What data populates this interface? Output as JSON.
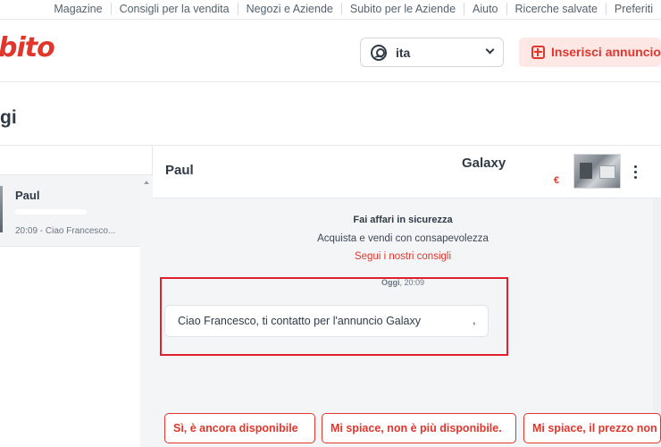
{
  "top_links": [
    "Magazine",
    "Consigli per la vendita",
    "Negozi e Aziende",
    "Subito per le Aziende",
    "Aiuto",
    "Ricerche salvate",
    "Preferiti"
  ],
  "header": {
    "logo_text": "bito",
    "language": "ita",
    "insert_ad_label": "Inserisci annuncio",
    "brand_color": "#e1362b"
  },
  "page": {
    "title": "gi"
  },
  "conversations": [
    {
      "name": "Paul",
      "preview": "20:09 - Ciao Francesco..."
    }
  ],
  "chat": {
    "contact_name": "Paul",
    "ad_title": "Galaxy",
    "ad_price": "€",
    "safety_title": "Fai affari in sicurezza",
    "safety_subtitle": "Acquista e vendi con consapevolezza",
    "safety_link": "Segui i nostri consigli",
    "date_label": "Oggi",
    "date_time": ", 20:09",
    "message": "Ciao Francesco, ti contatto per l'annuncio Galaxy",
    "message_trail": ",",
    "quick_replies": [
      "Sì, è ancora disponibile",
      "Mi spiace, non è più disponibile.",
      "Mi spiace, il prezzo non"
    ]
  },
  "icons": {
    "user": "user-circle-icon",
    "dropdown": "chevron-down-icon",
    "add": "plus-square-icon",
    "more": "kebab-menu-icon"
  }
}
